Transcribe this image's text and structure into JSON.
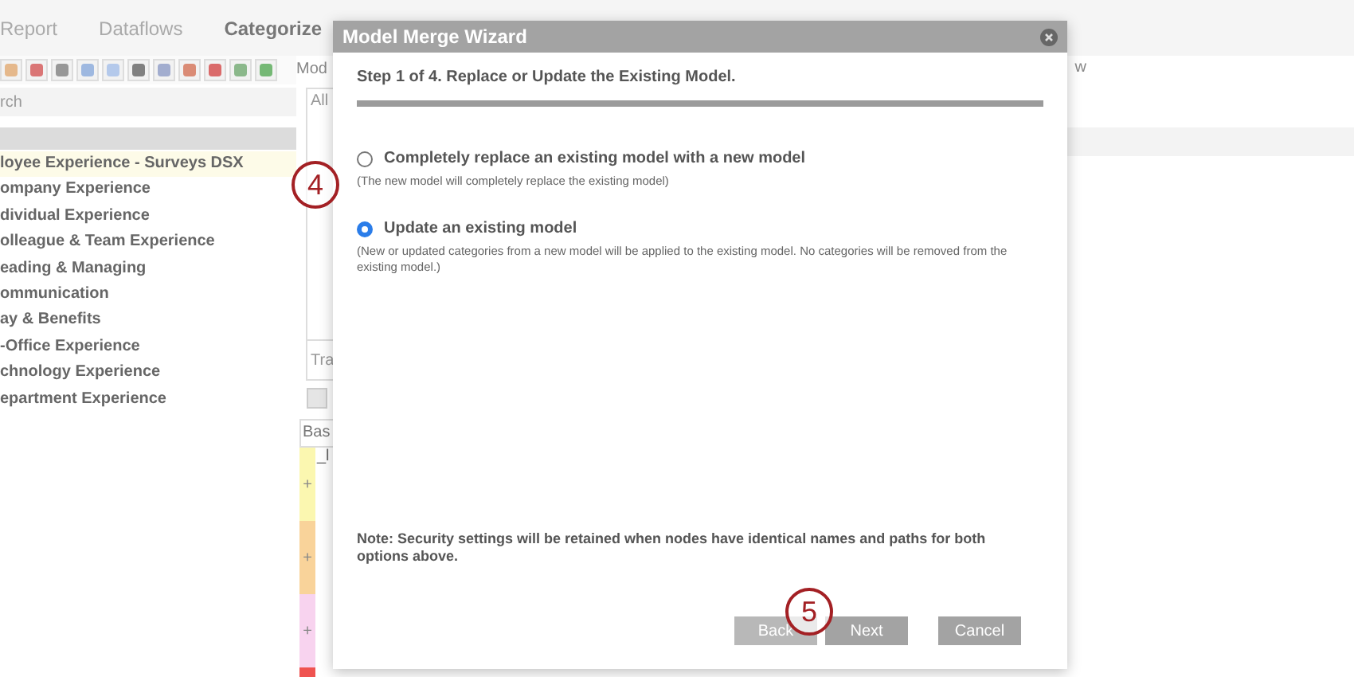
{
  "nav": {
    "tabs": [
      {
        "label": "Report",
        "selected": false
      },
      {
        "label": "Dataflows",
        "selected": false
      },
      {
        "label": "Categorize",
        "selected": true
      }
    ]
  },
  "sidebar": {
    "search": {
      "placeholder": "rch"
    },
    "items": [
      {
        "label": "loyee Experience - Surveys DSX",
        "selected": true
      },
      {
        "label": "ompany Experience",
        "selected": false
      },
      {
        "label": "dividual Experience",
        "selected": false
      },
      {
        "label": "olleague & Team Experience",
        "selected": false
      },
      {
        "label": "eading & Managing",
        "selected": false
      },
      {
        "label": "ommunication",
        "selected": false
      },
      {
        "label": "ay & Benefits",
        "selected": false
      },
      {
        "label": "-Office Experience",
        "selected": false
      },
      {
        "label": "chnology Experience",
        "selected": false
      },
      {
        "label": "epartment Experience",
        "selected": false
      }
    ]
  },
  "middle": {
    "label": "Mod",
    "tab": "All",
    "field": "Tra",
    "tab_2": "Bas",
    "row_text": "_l",
    "strips": [
      {
        "color": "#fbf7b0",
        "mark": "+"
      },
      {
        "color": "#f9d39a",
        "mark": "+"
      },
      {
        "color": "#f8d3ef",
        "mark": "+"
      },
      {
        "color": "#ef5350"
      }
    ]
  },
  "right": {
    "label": "w"
  },
  "dialog": {
    "title": "Model Merge Wizard",
    "step": "Step 1 of 4. Replace or Update the Existing Model.",
    "progress": {
      "level": 1
    },
    "options": [
      {
        "label": "Completely replace an existing model with a new model",
        "hint": "(The new model will completely replace the existing model)",
        "selected": false
      },
      {
        "label": "Update an existing model",
        "hint": "(New or updated categories from a new model will be applied to the existing model. No categories will be removed from the existing model.)",
        "selected": true
      }
    ],
    "note": "Note: Security settings will be retained when nodes have identical names and paths for both options above.",
    "buttons": [
      {
        "label": "Back",
        "disabled": true,
        "kind": "nav"
      },
      {
        "label": "Next",
        "disabled": false,
        "kind": "nav"
      },
      {
        "label": "Cancel",
        "disabled": false,
        "kind": "cancel"
      }
    ]
  },
  "callouts": [
    {
      "label": "4",
      "kind": "left"
    },
    {
      "label": "5",
      "kind": "bottom"
    }
  ]
}
